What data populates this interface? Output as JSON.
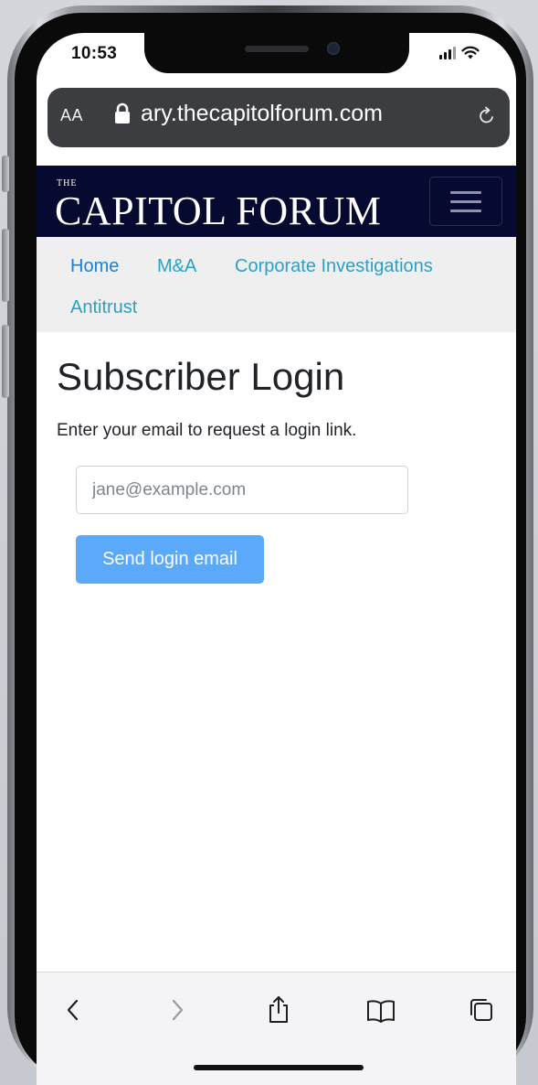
{
  "status_bar": {
    "time": "10:53"
  },
  "browser": {
    "text_size_label": "AA",
    "url": "ary.thecapitolforum.com"
  },
  "site": {
    "logo_small": "THE",
    "logo_main": "CAPITOL FORUM",
    "nav": [
      {
        "label": "Home",
        "color": "#1a7fd6"
      },
      {
        "label": "M&A",
        "color": "#2aa0c7"
      },
      {
        "label": "Corporate Investigations",
        "color": "#2aa0c7"
      },
      {
        "label": "Antitrust",
        "color": "#2aa0c7"
      }
    ]
  },
  "login": {
    "title": "Subscriber Login",
    "intro": "Enter your email to request a login link.",
    "email_placeholder": "jane@example.com",
    "email_value": "",
    "submit_label": "Send login email"
  },
  "toolbar": {
    "icons": [
      "back-icon",
      "forward-icon",
      "share-icon",
      "bookmarks-icon",
      "tabs-icon"
    ]
  },
  "colors": {
    "header_bg": "#060a30",
    "nav_bg": "#efefef",
    "button_bg": "#5aa9fb",
    "address_bar_bg": "#3c3d40"
  }
}
